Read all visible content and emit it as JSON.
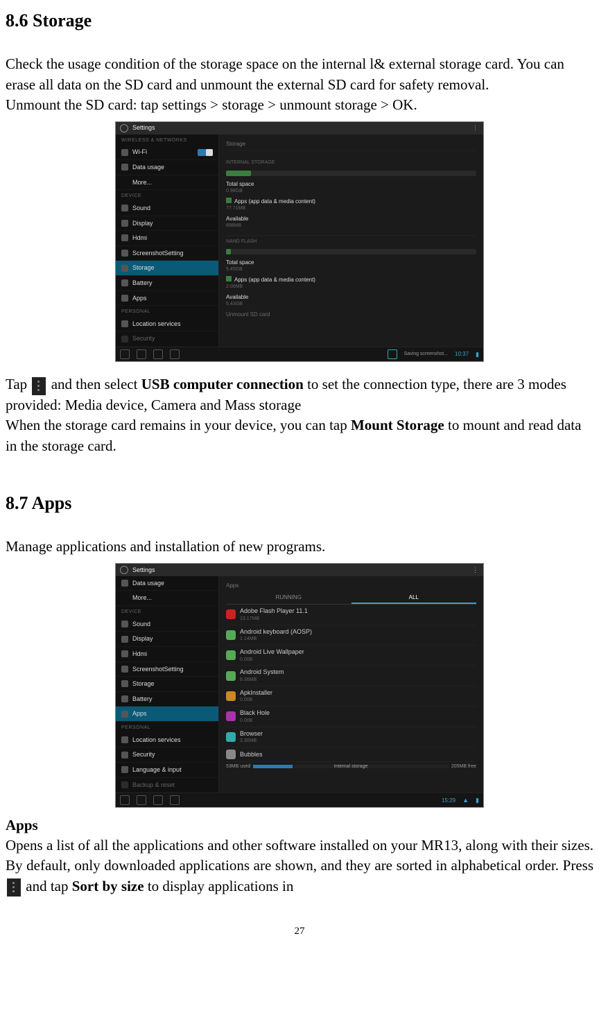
{
  "section_86": {
    "heading": "8.6 Storage",
    "para1": "Check the usage condition of the storage space on the internal l& external storage card. You can erase all data on the SD card and unmount the external SD card for safety removal.",
    "para2": "Unmount the SD card: tap settings > storage > unmount storage > OK.",
    "tap_pre": "Tap ",
    "tap_mid1": " and then select ",
    "tap_bold1": "USB computer connection",
    "tap_mid2": " to set the connection type, there are 3 modes provided: Media device, Camera and Mass storage",
    "mount_pre": "When the storage card remains in your device, you can tap ",
    "mount_bold": "Mount Storage",
    "mount_post": " to mount and read data in the storage card."
  },
  "section_87": {
    "heading": "8.7 Apps",
    "intro": "Manage applications and installation of new programs.",
    "apps_hdr": "Apps",
    "apps_para_pre": "Opens a list of all the applications and other software installed on your MR13, along with their sizes. By default, only downloaded applications are shown, and they are sorted in alphabetical order. Press ",
    "apps_para_mid": " and tap ",
    "apps_para_bold": "Sort by size",
    "apps_para_post": " to display applications in"
  },
  "page_number": "27",
  "shot1": {
    "title": "Settings",
    "side_groups": {
      "wireless": "WIRELESS & NETWORKS",
      "device": "DEVICE",
      "personal": "PERSONAL"
    },
    "items": {
      "wifi": "Wi-Fi",
      "data": "Data usage",
      "more": "More...",
      "sound": "Sound",
      "display": "Display",
      "hdmi": "Hdmi",
      "screenshot": "ScreenshotSetting",
      "storage": "Storage",
      "battery": "Battery",
      "apps": "Apps",
      "location": "Location services",
      "security": "Security"
    },
    "main_hdr": "Storage",
    "internal_hdr": "INTERNAL STORAGE",
    "total_label": "Total space",
    "total_val": "0.98GB",
    "apps_label": "Apps (app data & media content)",
    "apps_val": "77.71MB",
    "avail_label": "Available",
    "avail_val": "898MB",
    "nand_hdr": "NAND FLASH",
    "nand_total": "5.45GB",
    "nand_apps": "2.00MB",
    "nand_avail": "5.43GB",
    "unmount": "Unmount SD card",
    "toast": "Saving screenshot...",
    "clock": "10:37"
  },
  "shot2": {
    "title": "Settings",
    "items": {
      "data": "Data usage",
      "more": "More...",
      "sound": "Sound",
      "display": "Display",
      "hdmi": "Hdmi",
      "screenshot": "ScreenshotSetting",
      "storage": "Storage",
      "battery": "Battery",
      "apps": "Apps",
      "location": "Location services",
      "security": "Security",
      "lang": "Language & input",
      "backup": "Backup & reset"
    },
    "side_groups": {
      "device": "DEVICE",
      "personal": "PERSONAL"
    },
    "main_hdr": "Apps",
    "tab_running": "RUNNING",
    "tab_all": "ALL",
    "apps": [
      {
        "name": "Adobe Flash Player 11.1",
        "size": "13.17MB",
        "color": "#c22"
      },
      {
        "name": "Android keyboard (AOSP)",
        "size": "1.14MB",
        "color": "#5a5"
      },
      {
        "name": "Android Live Wallpaper",
        "size": "0.00B",
        "color": "#5a5"
      },
      {
        "name": "Android System",
        "size": "8.36MB",
        "color": "#5a5"
      },
      {
        "name": "ApkInstaller",
        "size": "0.00B",
        "color": "#c82"
      },
      {
        "name": "Black Hole",
        "size": "0.00B",
        "color": "#a3a"
      },
      {
        "name": "Browser",
        "size": "3.30MB",
        "color": "#3aa"
      },
      {
        "name": "Bubbles",
        "size": "",
        "color": "#888"
      }
    ],
    "foot_used": "53MB used",
    "foot_label": "Internal storage",
    "foot_free": "205MB free",
    "clock": "15:29"
  }
}
